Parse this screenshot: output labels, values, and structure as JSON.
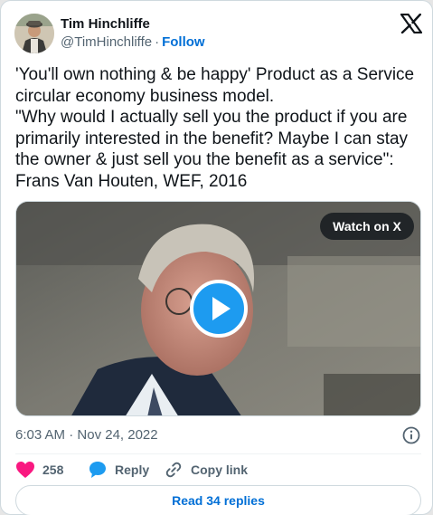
{
  "author": {
    "name": "Tim Hinchliffe",
    "handle": "@TimHinchliffe",
    "separator": "·",
    "follow_label": "Follow"
  },
  "tweet": {
    "lines": [
      "'You'll own nothing & be happy' Product as a Service",
      "circular economy business model.",
      "\"Why would I actually sell you the product if you are",
      "primarily interested in the benefit? Maybe I can stay",
      "the owner & just sell you the benefit as a service\":",
      "Frans Van Houten, WEF, 2016"
    ]
  },
  "media": {
    "watch_label": "Watch on X"
  },
  "meta": {
    "time": "6:03 AM",
    "separator": "·",
    "date": "Nov 24, 2022"
  },
  "actions": {
    "like_count": "258",
    "reply_label": "Reply",
    "copy_label": "Copy link"
  },
  "footer": {
    "read_replies_label": "Read 34 replies"
  },
  "colors": {
    "accent": "#1d9bf0",
    "link": "#006fd6",
    "like": "#f91880",
    "muted": "#536471"
  },
  "icons": [
    "x-logo-icon",
    "play-icon",
    "info-icon",
    "heart-icon",
    "reply-bubble-icon",
    "link-icon"
  ]
}
